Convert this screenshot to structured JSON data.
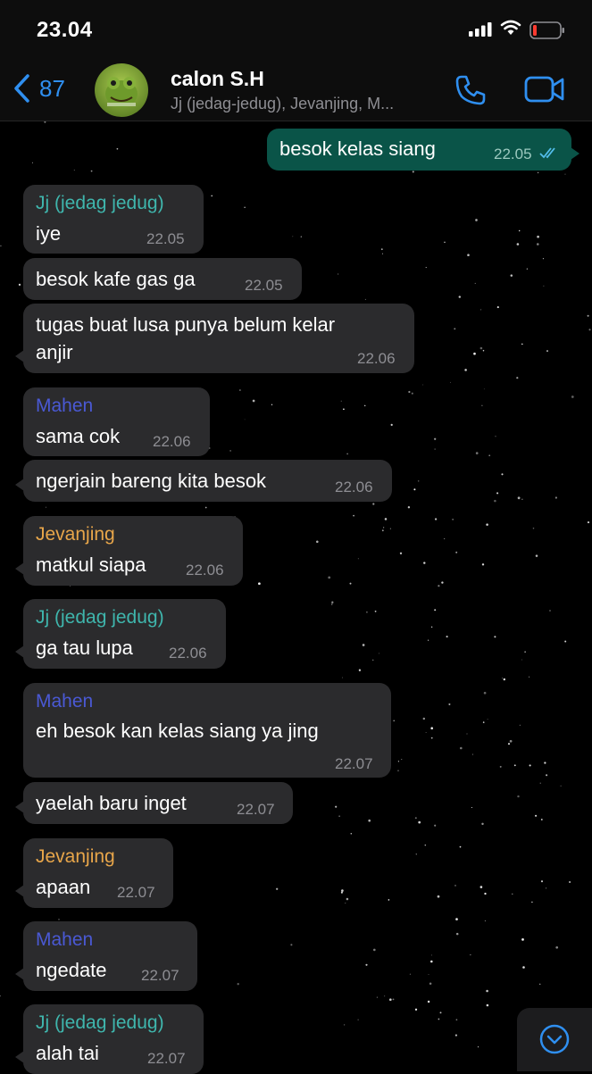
{
  "status_bar": {
    "time": "23.04"
  },
  "header": {
    "back_count": "87",
    "title": "calon S.H",
    "subtitle": "Jj (jedag-jedug), Jevanjing, M..."
  },
  "colors": {
    "sender_jj": "#3fb6ad",
    "sender_mahen": "#4a59d4",
    "sender_jevanjing": "#e8a64a",
    "accent": "#2f8ff0",
    "outgoing_bubble": "#0a5448",
    "incoming_bubble": "#2b2b2d"
  },
  "messages": [
    {
      "text": "besok kelas siang",
      "time": "22.05"
    },
    {
      "sender": "Jj (jedag jedug)",
      "text": "iye",
      "time": "22.05"
    },
    {
      "text": "besok kafe gas ga",
      "time": "22.05"
    },
    {
      "text": "tugas buat lusa punya belum kelar",
      "text2": "anjir",
      "time": "22.06"
    },
    {
      "sender": "Mahen",
      "text": "sama cok",
      "time": "22.06"
    },
    {
      "text": "ngerjain bareng kita besok",
      "time": "22.06"
    },
    {
      "sender": "Jevanjing",
      "text": "matkul siapa",
      "time": "22.06"
    },
    {
      "sender": "Jj (jedag jedug)",
      "text": "ga tau lupa",
      "time": "22.06"
    },
    {
      "sender": "Mahen",
      "text": "eh besok kan kelas siang ya jing",
      "time": "22.07"
    },
    {
      "text": "yaelah baru inget",
      "time": "22.07"
    },
    {
      "sender": "Jevanjing",
      "text": "apaan",
      "time": "22.07"
    },
    {
      "sender": "Mahen",
      "text": "ngedate",
      "time": "22.07"
    },
    {
      "sender": "Jj (jedag jedug)",
      "text": "alah tai",
      "time": "22.07"
    }
  ]
}
